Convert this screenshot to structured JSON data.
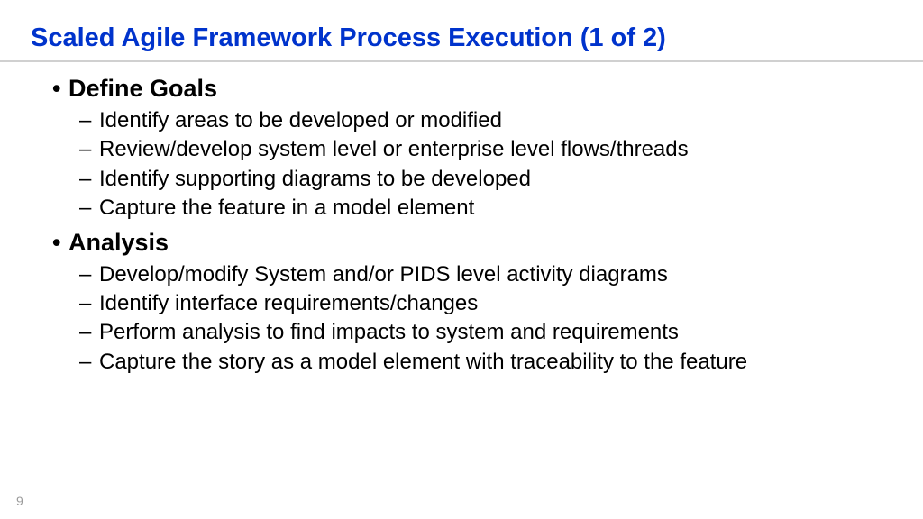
{
  "title": "Scaled Agile Framework Process Execution (1 of 2)",
  "sections": [
    {
      "heading": "Define Goals",
      "items": [
        "Identify areas to be developed or modified",
        "Review/develop system level or enterprise level flows/threads",
        "Identify supporting diagrams to be developed",
        "Capture the feature in a model element"
      ]
    },
    {
      "heading": "Analysis",
      "items": [
        "Develop/modify System and/or PIDS level activity diagrams",
        "Identify interface requirements/changes",
        "Perform analysis to find impacts to system and requirements",
        "Capture the story as a model element with traceability to the feature"
      ]
    }
  ],
  "page_number": "9",
  "glyphs": {
    "bullet": "•",
    "dash": "–"
  }
}
